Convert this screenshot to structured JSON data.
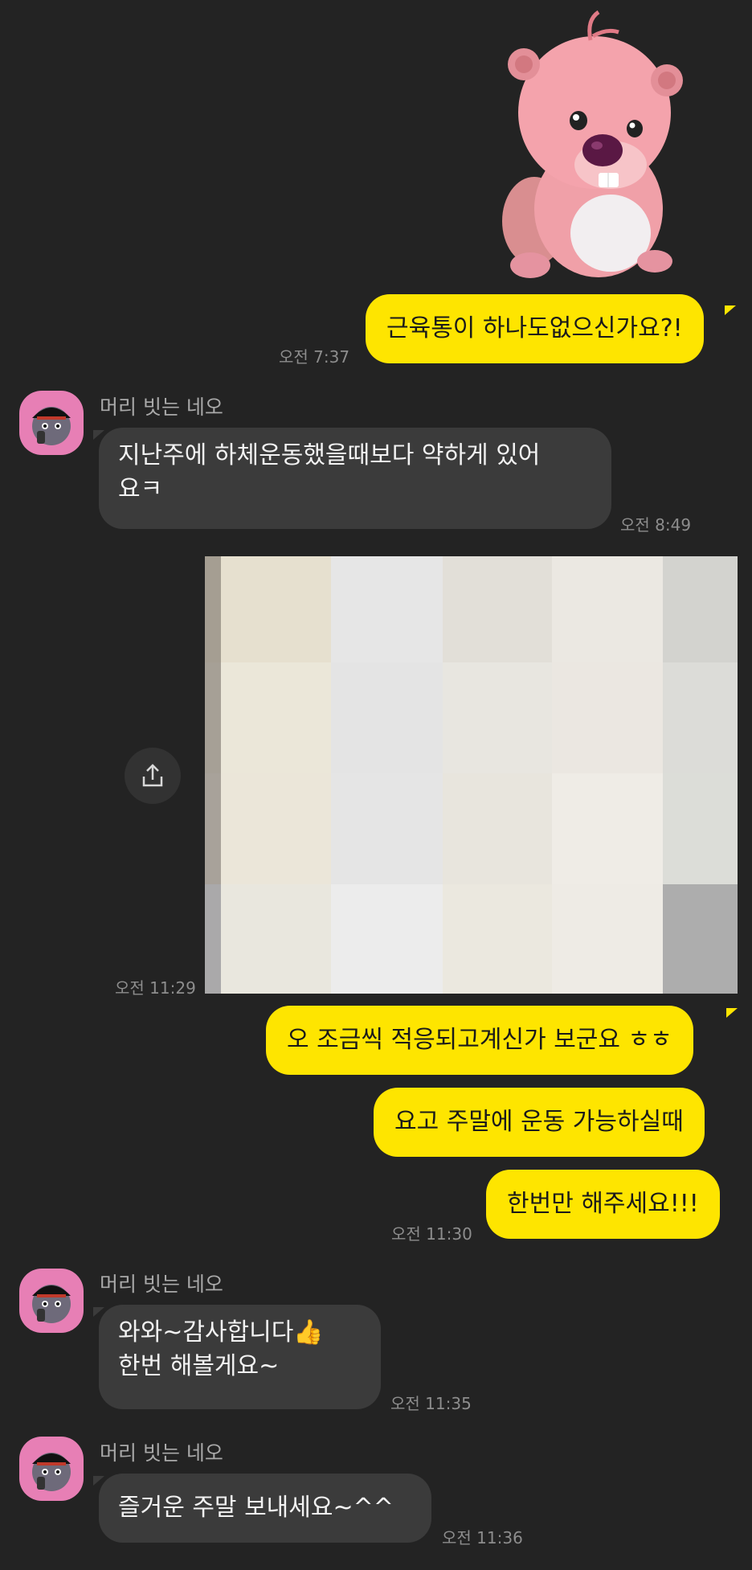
{
  "messages": {
    "m1": {
      "text": "근육통이 하나도없으신가요?!",
      "time": "오전 7:37"
    },
    "m2": {
      "sender": "머리 빗는 네오",
      "line1": "지난주에 하체운동했을때보다 약하게 있어",
      "line2": "요ㅋ",
      "time": "오전 8:49"
    },
    "m3": {
      "time": "오전 11:29"
    },
    "m4": {
      "text": "오 조금씩 적응되고계신가 보군요 ㅎㅎ"
    },
    "m5": {
      "text": "요고 주말에 운동 가능하실때"
    },
    "m6": {
      "text": "한번만 해주세요!!!",
      "time": "오전 11:30"
    },
    "m7": {
      "sender": "머리 빗는 네오",
      "line1": "와와~감사합니다",
      "emoji": "👍",
      "line2": "한번 해볼게요~",
      "time": "오전 11:35"
    },
    "m8": {
      "sender": "머리 빗는 네오",
      "text": "즐거운 주말 보내세요~^^",
      "time": "오전 11:36"
    }
  },
  "icons": {
    "share": "share-icon",
    "sticker": "beaver-sticker",
    "avatar": "neo-avatar"
  },
  "colors": {
    "background": "#232323",
    "my_bubble": "#FEE500",
    "other_bubble": "#3b3b3b",
    "avatar_bg": "#e77fb5"
  }
}
